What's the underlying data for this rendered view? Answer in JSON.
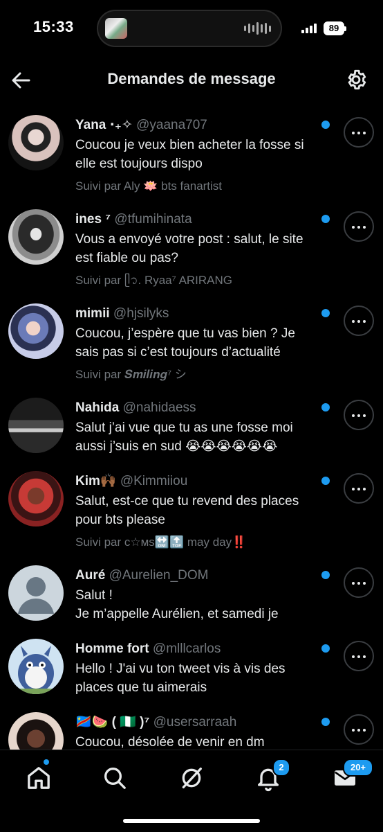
{
  "status_bar": {
    "time": "15:33",
    "battery": "89"
  },
  "header": {
    "title": "Demandes de message",
    "back_icon": "arrow-left-icon",
    "settings_icon": "gear-icon"
  },
  "colors": {
    "accent": "#1d9bf0",
    "background": "#000000",
    "text": "#e7e9ea",
    "secondary": "#71767b"
  },
  "requests": [
    {
      "name": "Yana ⋅₊✧",
      "handle": "@yaana707",
      "message": "Coucou je veux bien acheter la fosse si elle est toujours dispo",
      "followed_by": "Suivi par Aly 🪷 bts fanartist",
      "unread": true
    },
    {
      "name": "ines ⁷",
      "handle": "@tfumihinata",
      "message": "Vous a envoyé votre post : salut, le site est fiable ou pas?",
      "followed_by": "Suivi par ᥫ᭡. Ryaa⁷ ARIRANG",
      "unread": true
    },
    {
      "name": "mimii",
      "handle": "@hjsilyks",
      "message": "Coucou, j’espère que tu vas bien ? Je sais pas si c’est toujours d’actualité",
      "followed_by": "Suivi par 𝑺𝒎𝒊𝒍𝒊𝒏𝒈⁷ シ",
      "unread": true
    },
    {
      "name": "Nahida",
      "handle": "@nahidaess",
      "message": "Salut j’ai vue que tu as une fosse moi aussi j’suis en sud 😭😭😭😭😭😭",
      "followed_by": "",
      "unread": true
    },
    {
      "name": "Kim🙌🏾",
      "handle": "@Kimmiiou",
      "message": "Salut, est-ce que tu revend des places pour bts please",
      "followed_by": "Suivi par c☆ᴍs🔛🔝 may day‼️",
      "unread": true
    },
    {
      "name": "Auré",
      "handle": "@Aurelien_DOM",
      "message": "Salut !\nJe m’appelle Aurélien, et samedi je",
      "followed_by": "",
      "unread": true
    },
    {
      "name": "Homme fort",
      "handle": "@mlllcarlos",
      "message": "Hello ! J'ai vu ton tweet vis à vis des places que tu aimerais",
      "followed_by": "",
      "unread": true
    },
    {
      "name": "🇨🇩🍉 ( 🇳🇬 )⁷",
      "handle": "@usersarraah",
      "message": "Coucou, désolée de venir en dm",
      "followed_by": "",
      "unread": true
    }
  ],
  "nav": {
    "home_icon": "home-icon",
    "search_icon": "search-icon",
    "grok_icon": "grok-icon",
    "notifications_icon": "bell-icon",
    "notifications_badge": "2",
    "messages_icon": "mail-icon",
    "messages_badge": "20+"
  }
}
